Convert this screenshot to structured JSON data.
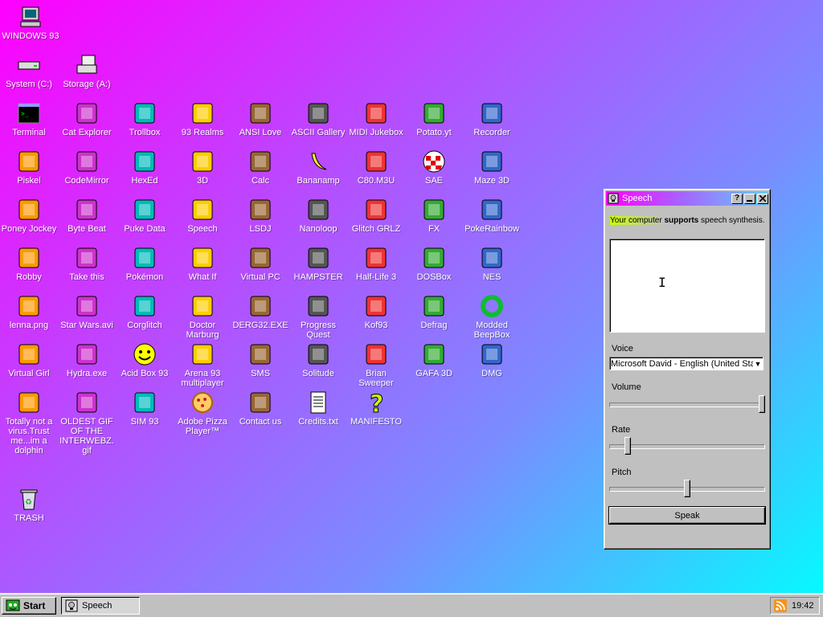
{
  "desktop": {
    "icons": [
      {
        "label": "WINDOWS 93",
        "icon": "computer-icon"
      },
      {
        "label": "System (C:)",
        "icon": "harddrive-icon"
      },
      {
        "label": "Storage (A:)",
        "icon": "floppy-drive-icon"
      },
      {
        "label": "Terminal",
        "icon": "terminal-icon"
      },
      {
        "label": "Cat Explorer",
        "icon": "cat-globe-icon"
      },
      {
        "label": "Trollbox",
        "icon": "chat-bubble-icon"
      },
      {
        "label": "93 Realms",
        "icon": "realms-icon"
      },
      {
        "label": "ANSI Love",
        "icon": "ansi-pencil-icon"
      },
      {
        "label": "ASCII Gallery",
        "icon": "ascii-123-icon"
      },
      {
        "label": "MIDI Jukebox",
        "icon": "piano-keys-icon"
      },
      {
        "label": "Potato.yt",
        "icon": "potato-icon"
      },
      {
        "label": "Recorder",
        "icon": "microphone-icon"
      },
      {
        "label": "Piskel",
        "icon": "palette-icon"
      },
      {
        "label": "CodeMirror",
        "icon": "unicorn-icon"
      },
      {
        "label": "HexEd",
        "icon": "cube-icon"
      },
      {
        "label": "3D",
        "icon": "teapot-icon"
      },
      {
        "label": "Calc",
        "icon": "calculator-icon"
      },
      {
        "label": "Bananamp",
        "icon": "banana-icon"
      },
      {
        "label": "C80.M3U",
        "icon": "speaker-file-icon"
      },
      {
        "label": "SAE",
        "icon": "amiga-ball-icon"
      },
      {
        "label": "Maze 3D",
        "icon": "maze-icon"
      },
      {
        "label": "Poney Jockey",
        "icon": "pony-icon"
      },
      {
        "label": "Byte Beat",
        "icon": "bytebeat-icon"
      },
      {
        "label": "Puke Data",
        "icon": "pd-icon"
      },
      {
        "label": "Speech",
        "icon": "speech-face-icon"
      },
      {
        "label": "LSDJ",
        "icon": "lsdj-icon"
      },
      {
        "label": "Nanoloop",
        "icon": "wave-icon"
      },
      {
        "label": "Glitch GRLZ",
        "icon": "lips-icon"
      },
      {
        "label": "FX",
        "icon": "atom-icon"
      },
      {
        "label": "PokeRainbow",
        "icon": "pokemon-trio-icon"
      },
      {
        "label": "Robby",
        "icon": "stick-figure-icon"
      },
      {
        "label": "Take this",
        "icon": "take-this-icon"
      },
      {
        "label": "Pokémon",
        "icon": "rock-icon"
      },
      {
        "label": "What If",
        "icon": "what-if-icon"
      },
      {
        "label": "Virtual PC",
        "icon": "virtual-pc-icon"
      },
      {
        "label": "HAMPSTER",
        "icon": "hamster-icon"
      },
      {
        "label": "Half-Life 3",
        "icon": "half-life-icon"
      },
      {
        "label": "DOSBox",
        "icon": "dosbox-icon"
      },
      {
        "label": "NES",
        "icon": "nes-icon"
      },
      {
        "label": "lenna.png",
        "icon": "image-file-icon"
      },
      {
        "label": "Star Wars.avi",
        "icon": "yoda-icon"
      },
      {
        "label": "Corglitch",
        "icon": "corgi-icon"
      },
      {
        "label": "Doctor Marburg",
        "icon": "doctor-icon"
      },
      {
        "label": "DERG32.EXE",
        "icon": "derg-icon"
      },
      {
        "label": "Progress Quest",
        "icon": "swords-icon"
      },
      {
        "label": "Kof93",
        "icon": "fighter-icon"
      },
      {
        "label": "Defrag",
        "icon": "defrag-icon"
      },
      {
        "label": "Modded BeepBox",
        "icon": "ring-icon"
      },
      {
        "label": "Virtual Girl",
        "icon": "girl-face-icon"
      },
      {
        "label": "Hydra.exe",
        "icon": "hydra-icon"
      },
      {
        "label": "Acid Box 93",
        "icon": "smiley-icon"
      },
      {
        "label": "Arena 93 multiplayer",
        "icon": "arena-cube-icon"
      },
      {
        "label": "SMS",
        "icon": "sms-console-icon"
      },
      {
        "label": "Solitude",
        "icon": "solitude-icon"
      },
      {
        "label": "Brian Sweeper",
        "icon": "mine-icon"
      },
      {
        "label": "GAFA 3D",
        "icon": "doomguy-icon"
      },
      {
        "label": "DMG",
        "icon": "gameboy-icon"
      },
      {
        "label": "Totally not a virus.Trust me...im a dolphin",
        "icon": "dolphin-icon"
      },
      {
        "label": "OLDEST GIF OF THE INTERWEBZ.gif",
        "icon": "gif-file-icon"
      },
      {
        "label": "SIM 93",
        "icon": "book-icon"
      },
      {
        "label": "Adobe Pizza Player™",
        "icon": "pizza-icon"
      },
      {
        "label": "Contact us",
        "icon": "letter-icon"
      },
      {
        "label": "Credits.txt",
        "icon": "text-file-icon"
      },
      {
        "label": "MANIFESTO",
        "icon": "question-icon"
      },
      {
        "label": "TRASH",
        "icon": "recycle-bin-icon"
      }
    ]
  },
  "speech_window": {
    "title": "Speech",
    "help_btn": "?",
    "info_pre": "Your computer ",
    "info_bold": "supports",
    "info_post": " speech synthesis.",
    "voice_label": "Voice",
    "voice_value": "Microsoft David - English (United States)",
    "volume_label": "Volume",
    "volume_level": 1.0,
    "rate_label": "Rate",
    "rate_level": 0.1,
    "pitch_label": "Pitch",
    "pitch_level": 0.5,
    "speak_label": "Speak"
  },
  "taskbar": {
    "start_label": "Start",
    "task_label": "Speech",
    "clock": "19:42"
  },
  "colors": {
    "window_face": "#c0c0c0",
    "title_gradient_start": "#ff00ff",
    "title_gradient_end": "#66ccff"
  }
}
